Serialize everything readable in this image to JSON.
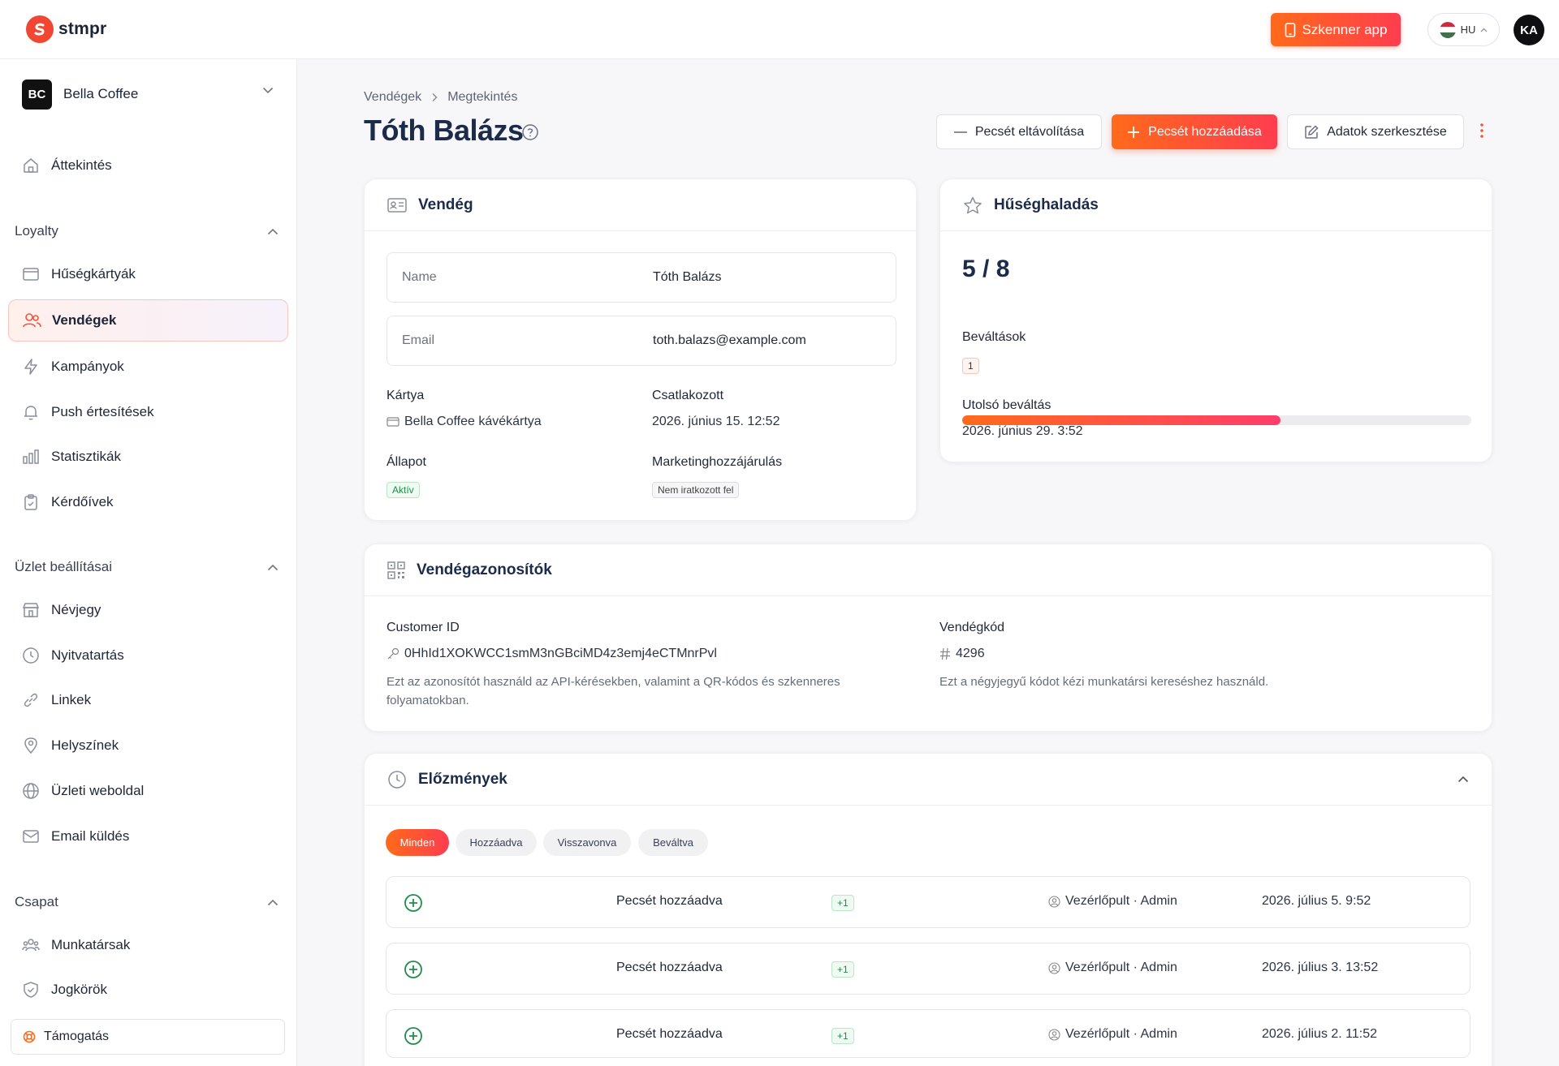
{
  "brand": {
    "name": "stmpr",
    "accent": "#ff5a2a"
  },
  "topbar": {
    "scanner_label": "Szkenner app",
    "lang_code": "HU",
    "avatar_initials": "KA"
  },
  "org": {
    "initials": "BC",
    "name": "Bella Coffee"
  },
  "sidebar": {
    "overview": "Áttekintés",
    "sections": [
      {
        "title": "Loyalty",
        "items": [
          "Hűségkártyák",
          "Vendégek",
          "Kampányok",
          "Push értesítések",
          "Statisztikák",
          "Kérdőívek"
        ]
      },
      {
        "title": "Üzlet beállításai",
        "items": [
          "Névjegy",
          "Nyitvatartás",
          "Linkek",
          "Helyszínek",
          "Üzleti weboldal",
          "Email küldés"
        ]
      },
      {
        "title": "Csapat",
        "items": [
          "Munkatársak",
          "Jogkörök"
        ]
      }
    ],
    "active_item": "Vendégek",
    "support_label": "Támogatás"
  },
  "breadcrumb": [
    "Vendégek",
    "Megtekintés"
  ],
  "page": {
    "title": "Tóth Balázs"
  },
  "actions": {
    "remove_stamp": "Pecsét eltávolítása",
    "add_stamp": "Pecsét hozzáadása",
    "edit_data": "Adatok szerkesztése"
  },
  "guest_card": {
    "title": "Vendég",
    "name_label": "Name",
    "name_value": "Tóth Balázs",
    "email_label": "Email",
    "email_value": "toth.balazs@example.com",
    "card_label": "Kártya",
    "card_value": "Bella Coffee kávékártya",
    "joined_label": "Csatlakozott",
    "joined_value": "2026. június 15. 12:52",
    "status_label": "Állapot",
    "status_value": "Aktív",
    "marketing_label": "Marketinghozzájárulás",
    "marketing_value": "Nem iratkozott fel"
  },
  "loyalty_card": {
    "title": "Hűséghaladás",
    "progress_text": "5 / 8",
    "progress_current": 5,
    "progress_total": 8,
    "redemptions_label": "Beváltások",
    "redemptions_value": "1",
    "last_redeem_label": "Utolsó beváltás",
    "last_redeem_value": "2026. június 29. 3:52"
  },
  "ids_card": {
    "title": "Vendégazonosítók",
    "customer_id_label": "Customer ID",
    "customer_id_value": "0HhId1XOKWCC1smM3nGBciMD4z3emj4eCTMnrPvl",
    "customer_id_help": "Ezt az azonosítót használd az API-kérésekben, valamint a QR-kódos és szkenneres folyamatokban.",
    "guest_code_label": "Vendégkód",
    "guest_code_value": "4296",
    "guest_code_help": "Ezt a négyjegyű kódot kézi munkatársi kereséshez használd."
  },
  "history": {
    "title": "Előzmények",
    "filters": [
      "Minden",
      "Hozzáadva",
      "Visszavonva",
      "Beváltva"
    ],
    "active_filter": "Minden",
    "rows": [
      {
        "label": "Pecsét hozzáadva",
        "delta": "+1",
        "source": "Vezérlőpult · Admin",
        "date": "2026. július 5. 9:52"
      },
      {
        "label": "Pecsét hozzáadva",
        "delta": "+1",
        "source": "Vezérlőpult · Admin",
        "date": "2026. július 3. 13:52"
      },
      {
        "label": "Pecsét hozzáadva",
        "delta": "+1",
        "source": "Vezérlőpult · Admin",
        "date": "2026. július 2. 11:52"
      }
    ]
  }
}
